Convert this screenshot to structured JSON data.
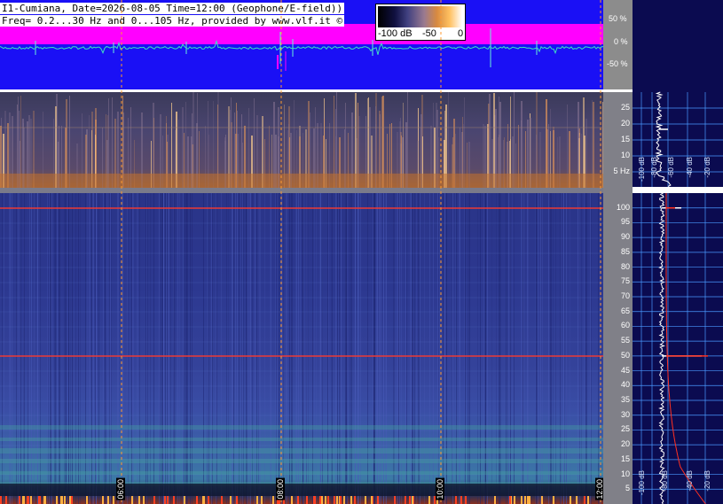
{
  "header": {
    "line1": "I1-Cumiana, Date=2026-08-05 Time=12:00 (Geophone/E-field))",
    "line2": "Freq= 0.2...30 Hz and 0...105 Hz, provided by www.vlf.it ©"
  },
  "colorbar": {
    "labels": [
      "-100 dB",
      "-50",
      "0"
    ]
  },
  "waveform_scale": {
    "labels": [
      "50 %",
      "0 %",
      "-50 %"
    ]
  },
  "low_band": {
    "ticks": [
      {
        "v": 25,
        "label": "25"
      },
      {
        "v": 20,
        "label": "20"
      },
      {
        "v": 15,
        "label": "15"
      },
      {
        "v": 10,
        "label": "10"
      },
      {
        "v": 5,
        "label": "5 Hz"
      }
    ],
    "db_labels": [
      "-100 dB",
      "-80 dB",
      "-60 dB",
      "-40 dB",
      "-20 dB"
    ]
  },
  "high_band": {
    "ticks": [
      {
        "v": 100,
        "label": "100"
      },
      {
        "v": 95,
        "label": "95"
      },
      {
        "v": 90,
        "label": "90"
      },
      {
        "v": 85,
        "label": "85"
      },
      {
        "v": 80,
        "label": "80"
      },
      {
        "v": 75,
        "label": "75"
      },
      {
        "v": 70,
        "label": "70"
      },
      {
        "v": 65,
        "label": "65"
      },
      {
        "v": 60,
        "label": "60"
      },
      {
        "v": 55,
        "label": "55"
      },
      {
        "v": 50,
        "label": "50"
      },
      {
        "v": 45,
        "label": "45"
      },
      {
        "v": 40,
        "label": "40"
      },
      {
        "v": 35,
        "label": "35"
      },
      {
        "v": 30,
        "label": "30"
      },
      {
        "v": 25,
        "label": "25"
      },
      {
        "v": 20,
        "label": "20"
      },
      {
        "v": 15,
        "label": "15"
      },
      {
        "v": 10,
        "label": "10"
      },
      {
        "v": 5,
        "label": "5"
      }
    ],
    "db_labels": [
      "-100 dB",
      "-80 dB",
      "-40 dB",
      "-20 dB"
    ]
  },
  "time_labels": [
    "06:00",
    "08:00",
    "10:00",
    "12:00"
  ],
  "colors": {
    "waveform_bg": "#1a10f5",
    "waveform_band": "#ff00ff",
    "waveform_trace": "#40e0c0",
    "spectro_dark": "#1e2a70",
    "spectro_mid": "#3a48a0",
    "axis_bg": "#0b0b50",
    "grid_line": "#4a9aff",
    "hum_line": "#ff3020",
    "marker_line": "#ff9a30"
  }
}
